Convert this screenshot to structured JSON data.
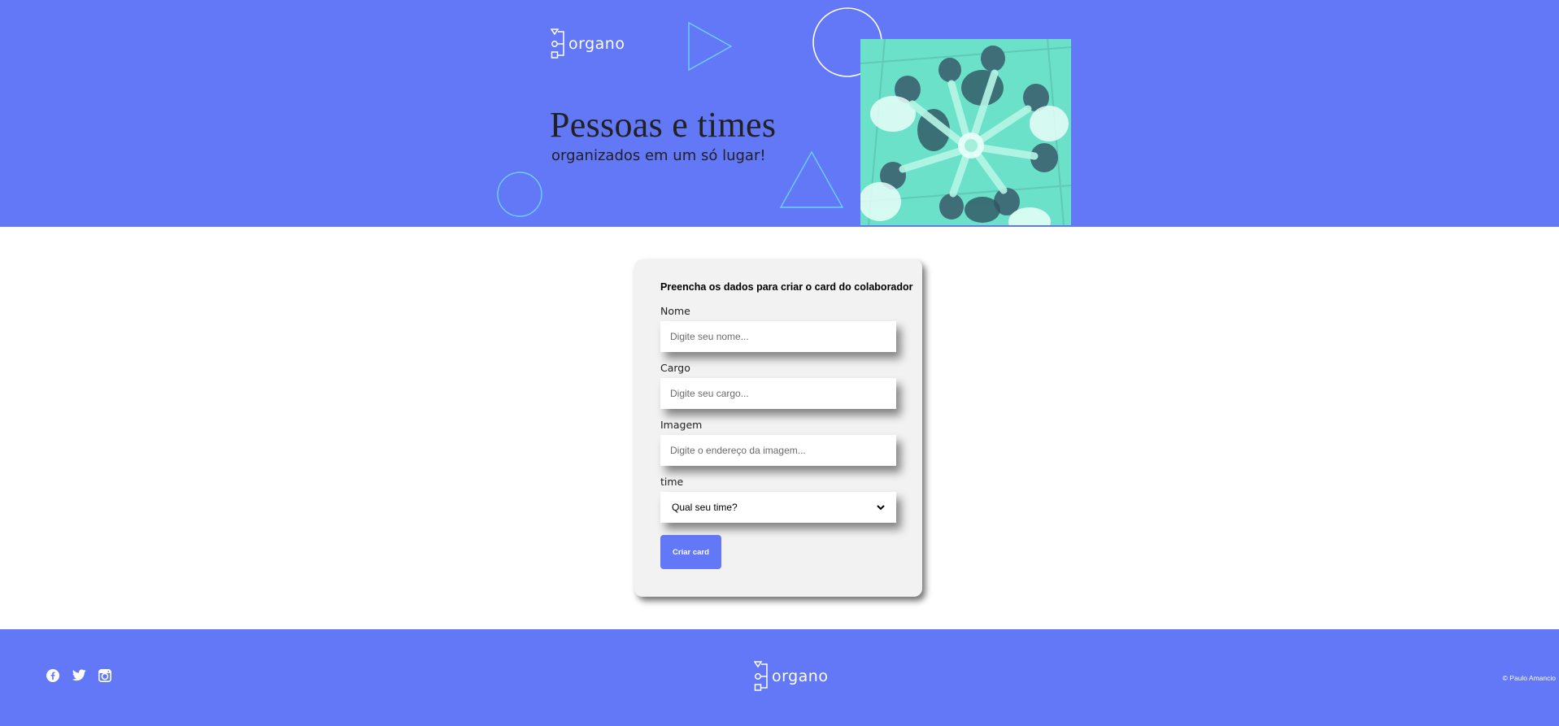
{
  "colors": {
    "brand": "#6278f7",
    "accent": "#6bd1ff",
    "photo_tint": "#6fe7cf",
    "card_bg": "#f2f2f2"
  },
  "header": {
    "logo_text": "organo",
    "title": "Pessoas e times",
    "subtitle": "organizados em um só lugar!",
    "photo_icon": "team-hands-photo"
  },
  "form": {
    "title": "Preencha os dados para criar o card do colaborador",
    "fields": [
      {
        "label": "Nome",
        "placeholder": "Digite seu nome...",
        "value": ""
      },
      {
        "label": "Cargo",
        "placeholder": "Digite seu cargo...",
        "value": ""
      },
      {
        "label": "Imagem",
        "placeholder": "Digite o endereço da imagem...",
        "value": ""
      }
    ],
    "team_select": {
      "label": "time",
      "selected": "Qual seu time?"
    },
    "submit_label": "Criar card"
  },
  "footer": {
    "social_icons": [
      "facebook-icon",
      "twitter-icon",
      "instagram-icon"
    ],
    "logo_text": "organo",
    "credit": "© Paulo Amancio"
  }
}
